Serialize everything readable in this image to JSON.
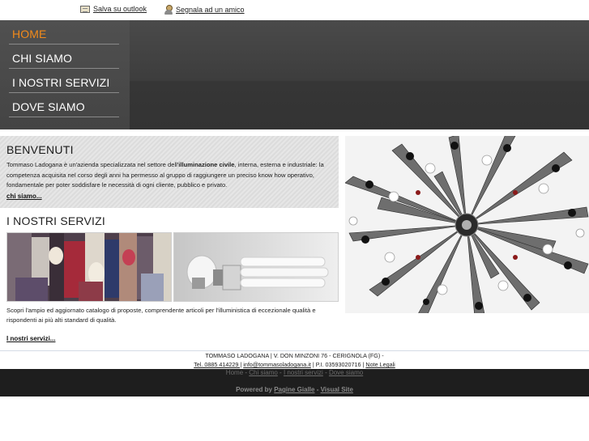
{
  "topbar": {
    "outlook_label": "Salva su outlook",
    "friend_label": "Segnala ad un amico",
    "outlook_icon": "address-card-icon",
    "friend_icon": "user-icon"
  },
  "nav": {
    "items": [
      {
        "label": "HOME",
        "active": true
      },
      {
        "label": "CHI SIAMO",
        "active": false
      },
      {
        "label": "I NOSTRI SERVIZI",
        "active": false
      },
      {
        "label": "DOVE SIAMO",
        "active": false
      }
    ],
    "active_color": "#f28a1a"
  },
  "welcome": {
    "title": "BENVENUTI",
    "text_pre": "Tommaso Ladogana è un'azienda specializzata nel settore dell'",
    "text_bold": "illuminazione civile",
    "text_post": ", interna, esterna e industriale: la competenza acquisita nel corso degli anni ha permesso al gruppo di raggiungere un preciso know how operativo, fondamentale per poter soddisfare le necessità di ogni cliente, pubblico e privato.",
    "link": "chi siamo..."
  },
  "services": {
    "title": "I NOSTRI SERVIZI",
    "text": "Scopri l'ampio ed aggiornato catalogo di proposte, comprendente articoli per l'illuministica di eccezionale qualità e rispondenti ai più alti standard di qualità.",
    "link": "I nostri servizi..."
  },
  "footer": {
    "address": "TOMMASO LADOGANA | V. DON MINZONI 76 - CERIGNOLA (FG) -",
    "tel": "Tel. 0885 414229 |",
    "email": "info@tommasoladogana.it",
    "piva": "| P.I. 03593020716 |",
    "legal": "Note Legali",
    "nav": [
      "Home",
      "Chi siamo",
      "I nostri servizi",
      "Dove siamo"
    ],
    "powered_by": "Powered by",
    "pagine_gialle": "Pagine Gialle",
    "visual_site": "Visual Site"
  }
}
